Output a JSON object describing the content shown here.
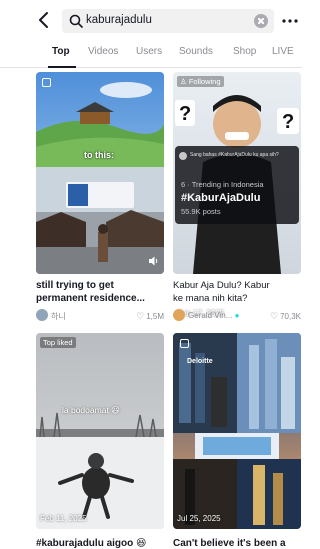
{
  "search": {
    "query": "kaburajadulu"
  },
  "tabs": [
    {
      "label": "Top"
    },
    {
      "label": "Videos"
    },
    {
      "label": "Users"
    },
    {
      "label": "Sounds"
    },
    {
      "label": "Shop"
    },
    {
      "label": "LIVE"
    }
  ],
  "cards": [
    {
      "overlay_text": "to this:",
      "caption_line1": "still trying to get",
      "caption_line2": "permanent residence...",
      "author": "하니",
      "likes": "1,5M"
    },
    {
      "following_badge": "Following",
      "comment_text": "Sang bahas #KaburAjaDulu ku apa sih?",
      "trending_label": "6 · Trending in Indonesia",
      "hashtag": "#KaburAjaDulu",
      "posts_count": "55.9K posts",
      "date": "Feb 17, 2025",
      "caption_line1": "Kabur Aja Dulu? Kabur",
      "caption_line2": "ke mana nih kita?",
      "author": "Gerald Vin...",
      "likes": "70,3K"
    },
    {
      "badge": "Top liked",
      "overlay_text": "la bodoamat",
      "date": "Feb 11, 2025",
      "caption_line1": "#kaburajadulu aigoo"
    },
    {
      "deloitte": "Deloitte",
      "date": "Jul 25, 2025",
      "caption_line1": "Can't believe it's been a"
    }
  ],
  "colors": {
    "text": "#161823",
    "muted": "#8a8b91",
    "accent_blue": "#20d5ec"
  }
}
